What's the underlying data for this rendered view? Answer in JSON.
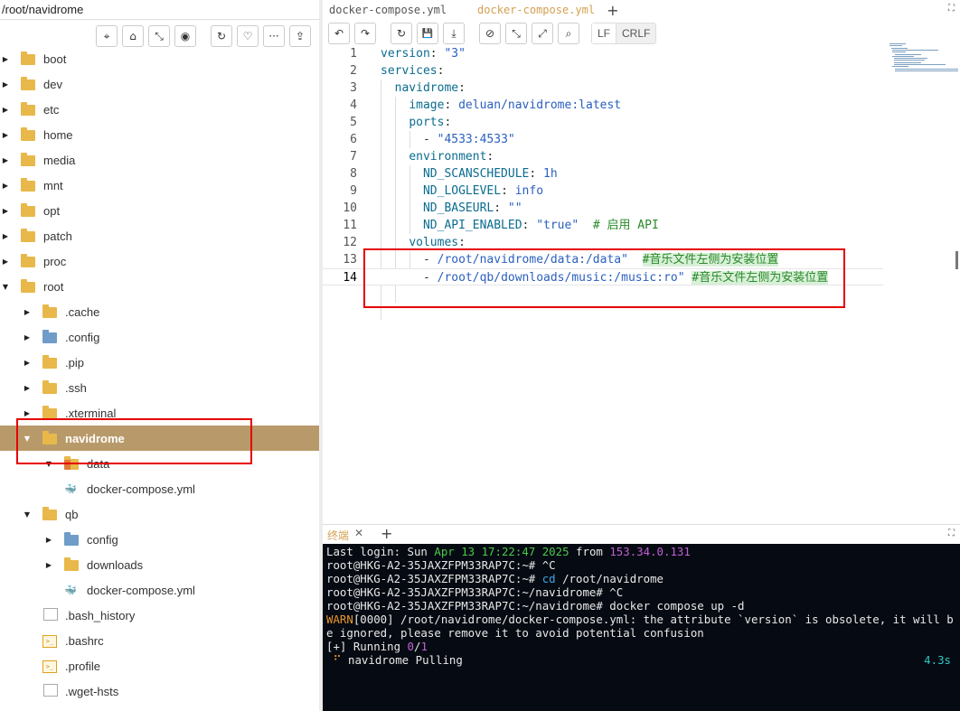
{
  "path": "/root/navidrome",
  "file_toolbar": {
    "icons": [
      "locate-icon",
      "home-icon",
      "collapse-icon",
      "eye-icon",
      "refresh-icon",
      "heart-icon",
      "more-icon",
      "upload-icon"
    ],
    "more_label": "···"
  },
  "tree": [
    {
      "name": "boot",
      "icon": "folder",
      "depth": 0,
      "expand": "closed"
    },
    {
      "name": "dev",
      "icon": "folder",
      "depth": 0,
      "expand": "closed"
    },
    {
      "name": "etc",
      "icon": "folder",
      "depth": 0,
      "expand": "closed"
    },
    {
      "name": "home",
      "icon": "folder",
      "depth": 0,
      "expand": "closed"
    },
    {
      "name": "media",
      "icon": "folder",
      "depth": 0,
      "expand": "closed"
    },
    {
      "name": "mnt",
      "icon": "folder",
      "depth": 0,
      "expand": "closed"
    },
    {
      "name": "opt",
      "icon": "folder",
      "depth": 0,
      "expand": "closed"
    },
    {
      "name": "patch",
      "icon": "folder",
      "depth": 0,
      "expand": "closed"
    },
    {
      "name": "proc",
      "icon": "folder",
      "depth": 0,
      "expand": "closed"
    },
    {
      "name": "root",
      "icon": "folder",
      "depth": 0,
      "expand": "open"
    },
    {
      "name": ".cache",
      "icon": "folder",
      "depth": 1,
      "expand": "closed"
    },
    {
      "name": ".config",
      "icon": "folder-blue",
      "depth": 1,
      "expand": "closed"
    },
    {
      "name": ".pip",
      "icon": "folder",
      "depth": 1,
      "expand": "closed"
    },
    {
      "name": ".ssh",
      "icon": "folder",
      "depth": 1,
      "expand": "closed"
    },
    {
      "name": ".xterminal",
      "icon": "folder",
      "depth": 1,
      "expand": "closed"
    },
    {
      "name": "navidrome",
      "icon": "folder",
      "depth": 1,
      "expand": "open",
      "selected": true
    },
    {
      "name": "data",
      "icon": "folder-mixed",
      "depth": 2,
      "expand": "open"
    },
    {
      "name": "docker-compose.yml",
      "icon": "docker",
      "depth": 2,
      "expand": "none"
    },
    {
      "name": "qb",
      "icon": "folder",
      "depth": 1,
      "expand": "open"
    },
    {
      "name": "config",
      "icon": "folder-blue",
      "depth": 2,
      "expand": "closed"
    },
    {
      "name": "downloads",
      "icon": "folder",
      "depth": 2,
      "expand": "closed"
    },
    {
      "name": "docker-compose.yml",
      "icon": "docker",
      "depth": 2,
      "expand": "none"
    },
    {
      "name": ".bash_history",
      "icon": "file",
      "depth": 1,
      "expand": "none"
    },
    {
      "name": ".bashrc",
      "icon": "terminal",
      "depth": 1,
      "expand": "none"
    },
    {
      "name": ".profile",
      "icon": "terminal",
      "depth": 1,
      "expand": "none"
    },
    {
      "name": ".wget-hsts",
      "icon": "file",
      "depth": 1,
      "expand": "none"
    }
  ],
  "editor": {
    "tabs": [
      {
        "label": "docker-compose.yml",
        "active": false
      },
      {
        "label": "docker-compose.yml",
        "active": true
      }
    ],
    "toolbar_icons": [
      "undo-icon",
      "redo-icon",
      "reload-icon",
      "save-icon",
      "download-icon",
      "compass-icon",
      "collapse-icon",
      "expand-icon",
      "search-icon"
    ],
    "line_endings": [
      "LF",
      "CRLF"
    ],
    "current_line": 14,
    "lines": [
      [
        [
          "k",
          "version"
        ],
        [
          "p",
          ": "
        ],
        [
          "s",
          "\"3\""
        ]
      ],
      [
        [
          "k",
          "services"
        ],
        [
          "p",
          ":"
        ]
      ],
      [
        [
          "p",
          "  "
        ],
        [
          "k",
          "navidrome"
        ],
        [
          "p",
          ":"
        ]
      ],
      [
        [
          "p",
          "    "
        ],
        [
          "k",
          "image"
        ],
        [
          "p",
          ": "
        ],
        [
          "v",
          "deluan/navidrome:latest"
        ]
      ],
      [
        [
          "p",
          "    "
        ],
        [
          "k",
          "ports"
        ],
        [
          "p",
          ":"
        ]
      ],
      [
        [
          "p",
          "      - "
        ],
        [
          "s",
          "\"4533:4533\""
        ]
      ],
      [
        [
          "p",
          "    "
        ],
        [
          "k",
          "environment"
        ],
        [
          "p",
          ":"
        ]
      ],
      [
        [
          "p",
          "      "
        ],
        [
          "k",
          "ND_SCANSCHEDULE"
        ],
        [
          "p",
          ": "
        ],
        [
          "v",
          "1h"
        ]
      ],
      [
        [
          "p",
          "      "
        ],
        [
          "k",
          "ND_LOGLEVEL"
        ],
        [
          "p",
          ": "
        ],
        [
          "v",
          "info"
        ]
      ],
      [
        [
          "p",
          "      "
        ],
        [
          "k",
          "ND_BASEURL"
        ],
        [
          "p",
          ": "
        ],
        [
          "s",
          "\"\""
        ]
      ],
      [
        [
          "p",
          "      "
        ],
        [
          "k",
          "ND_API_ENABLED"
        ],
        [
          "p",
          ": "
        ],
        [
          "s",
          "\"true\""
        ],
        [
          "p",
          "  "
        ],
        [
          "c",
          "# 启用 API"
        ]
      ],
      [
        [
          "p",
          "    "
        ],
        [
          "k",
          "volumes"
        ],
        [
          "p",
          ":"
        ]
      ],
      [
        [
          "p",
          "      - "
        ],
        [
          "v",
          "/root/navidrome/data:/data\""
        ],
        [
          "p",
          "  "
        ],
        [
          "ch",
          "#音乐文件左侧为安装位置"
        ]
      ],
      [
        [
          "p",
          "      - "
        ],
        [
          "v",
          "/root/qb/downloads/music:/music:ro\""
        ],
        [
          "p",
          " "
        ],
        [
          "ch",
          "#音乐文件左侧为安装位置"
        ]
      ]
    ]
  },
  "terminal": {
    "tab_label": "终端",
    "lines": [
      [
        [
          "w",
          "Last login: Sun "
        ],
        [
          "g",
          "Apr 13 17:22:47 2025"
        ],
        [
          "w",
          " from "
        ],
        [
          "m",
          "153.34.0.131"
        ]
      ],
      [
        [
          "w",
          "root@HKG-A2-35JAXZFPM33RAP7C:~# ^C"
        ]
      ],
      [
        [
          "w",
          "root@HKG-A2-35JAXZFPM33RAP7C:~# "
        ],
        [
          "b",
          "cd"
        ],
        [
          "w",
          " /root/navidrome"
        ]
      ],
      [
        [
          "w",
          "root@HKG-A2-35JAXZFPM33RAP7C:~/navidrome# ^C"
        ]
      ],
      [
        [
          "w",
          "root@HKG-A2-35JAXZFPM33RAP7C:~/navidrome# docker compose up -d"
        ]
      ],
      [
        [
          "o",
          "WARN"
        ],
        [
          "w",
          "[0000] /root/navidrome/docker-compose.yml: the attribute `version` is obsolete, it will b"
        ]
      ],
      [
        [
          "w",
          "e ignored, please remove it to avoid potential confusion"
        ]
      ],
      [
        [
          "w",
          "[+] Running "
        ],
        [
          "m",
          "0"
        ],
        [
          "w",
          "/"
        ],
        [
          "m",
          "1"
        ]
      ],
      [
        [
          "o",
          " ⠋"
        ],
        [
          "w",
          " navidrome Pulling"
        ]
      ]
    ],
    "pull_time": "4.3s"
  }
}
